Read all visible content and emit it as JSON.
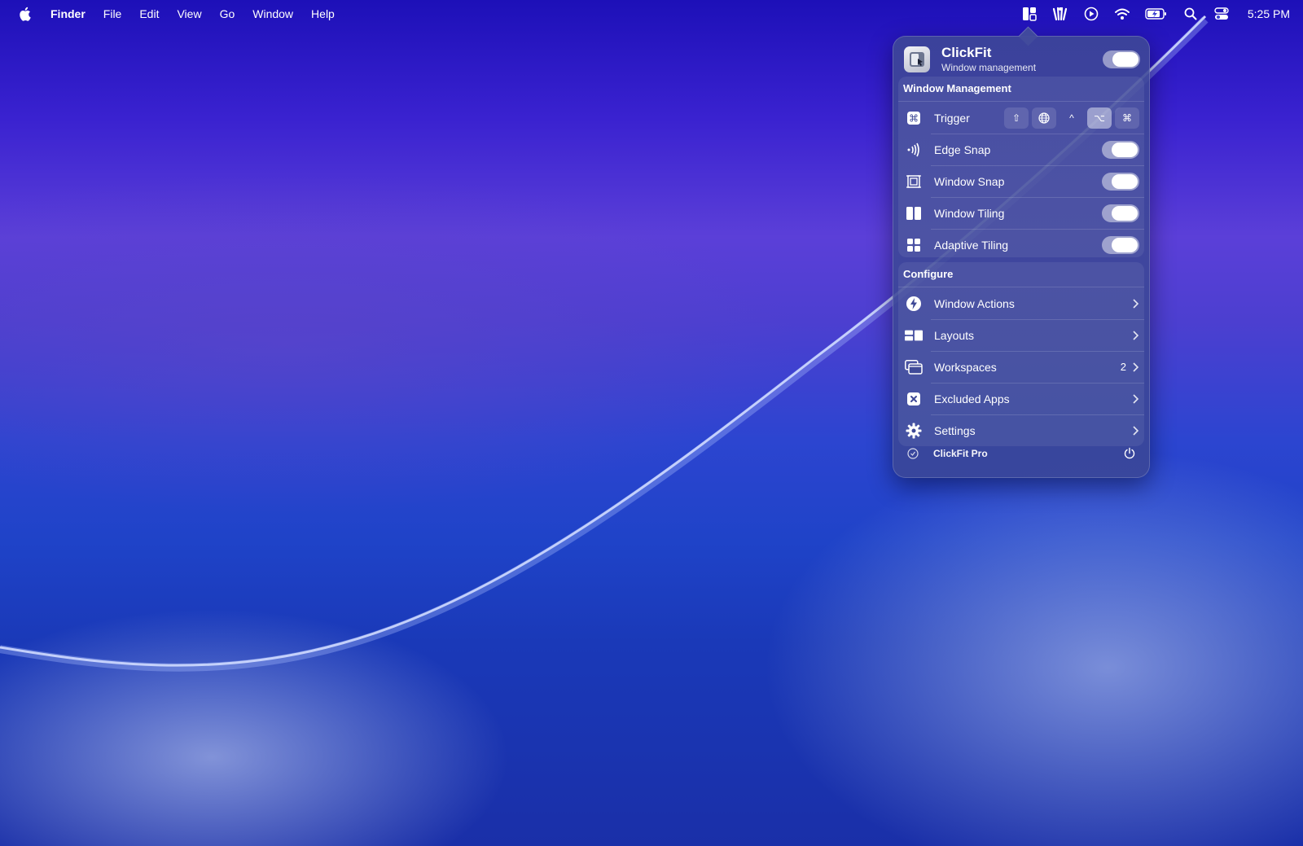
{
  "menubar": {
    "app_name": "Finder",
    "menus": [
      "File",
      "Edit",
      "View",
      "Go",
      "Window",
      "Help"
    ],
    "clock": "5:25 PM",
    "status_icons": [
      "clickfit-icon",
      "accessibility-icon",
      "play-circle-icon",
      "wifi-icon",
      "battery-charging-icon",
      "spotlight-search-icon",
      "control-center-icon"
    ]
  },
  "popover": {
    "app_title": "ClickFit",
    "app_subtitle": "Window management",
    "master_toggle_on": true,
    "window_management": {
      "heading": "Window Management",
      "trigger_label": "Trigger",
      "trigger_keys": [
        {
          "glyph": "⇧",
          "name": "shift-key",
          "active": false
        },
        {
          "glyph": "🌐",
          "name": "globe-key",
          "active": false
        },
        {
          "glyph": "^",
          "name": "control-key",
          "active": false
        },
        {
          "glyph": "⌥",
          "name": "option-key",
          "active": true
        },
        {
          "glyph": "⌘",
          "name": "command-key",
          "active": false
        }
      ],
      "items": [
        {
          "label": "Edge Snap",
          "icon": "edge-snap-icon",
          "on": true
        },
        {
          "label": "Window Snap",
          "icon": "window-snap-icon",
          "on": true
        },
        {
          "label": "Window Tiling",
          "icon": "window-tiling-icon",
          "on": true
        },
        {
          "label": "Adaptive Tiling",
          "icon": "adaptive-tiling-icon",
          "on": true
        }
      ]
    },
    "configure": {
      "heading": "Configure",
      "items": [
        {
          "label": "Window Actions",
          "icon": "lightning-icon",
          "badge": ""
        },
        {
          "label": "Layouts",
          "icon": "layouts-icon",
          "badge": ""
        },
        {
          "label": "Workspaces",
          "icon": "workspaces-icon",
          "badge": "2"
        },
        {
          "label": "Excluded Apps",
          "icon": "excluded-apps-icon",
          "badge": ""
        },
        {
          "label": "Settings",
          "icon": "gear-icon",
          "badge": ""
        }
      ]
    },
    "footer": {
      "label": "ClickFit Pro"
    }
  },
  "colors": {
    "accent_toggle": "#e1e4f0",
    "popover_bg": "#3e4896"
  }
}
